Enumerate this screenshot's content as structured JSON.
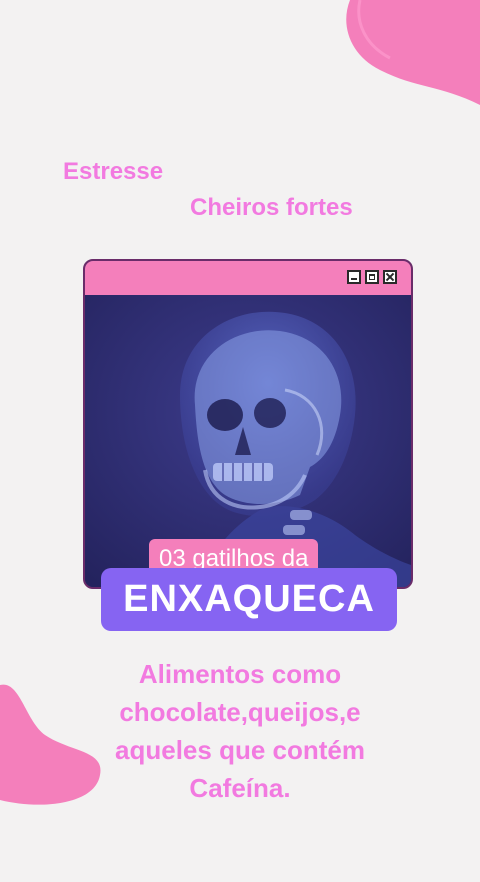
{
  "triggers": {
    "first": "Estresse",
    "second": "Cheiros fortes"
  },
  "window": {
    "image": "skull-xray-illustration",
    "buttons": [
      "minimize-icon",
      "maximize-icon",
      "close-icon"
    ]
  },
  "card": {
    "tag": "03 gatilhos da",
    "headline": "ENXAQUECA"
  },
  "body": {
    "text": "Alimentos como chocolate,queijos,e aqueles que contém Cafeína."
  },
  "colors": {
    "background": "#f3f2f2",
    "pink": "#f47fbb",
    "text_pink": "#f27ae0",
    "purple": "#8664f2",
    "navy": "#2c2b6e"
  }
}
